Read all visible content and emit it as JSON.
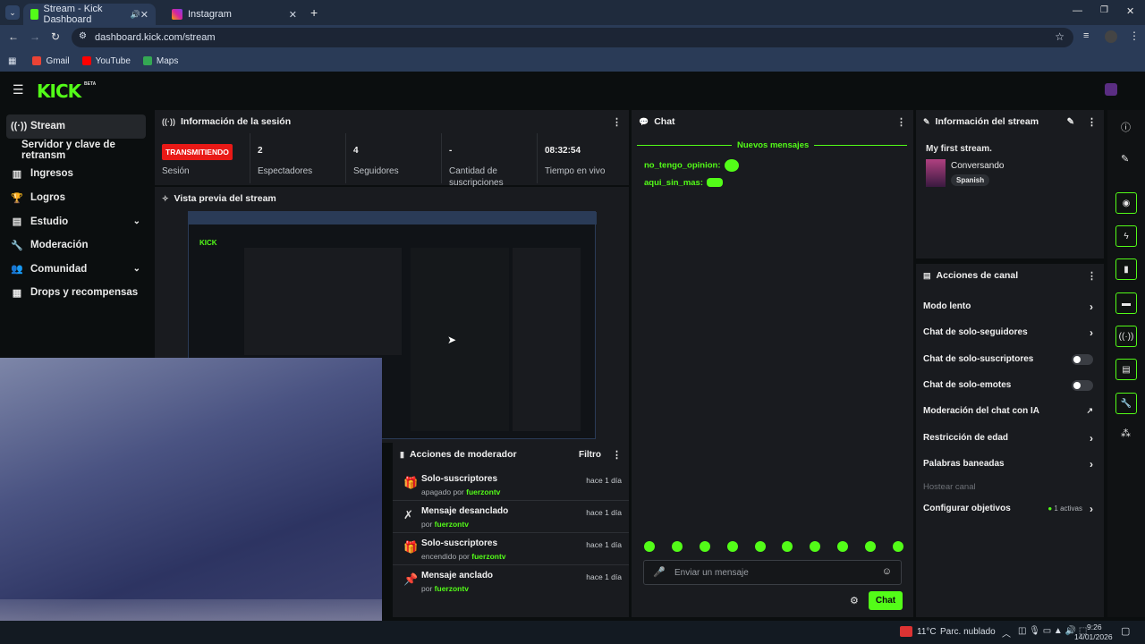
{
  "browser": {
    "tabs": [
      {
        "title": "Stream - Kick Dashboard",
        "active": true
      },
      {
        "title": "Instagram",
        "active": false
      }
    ],
    "url": "dashboard.kick.com/stream",
    "bookmarks": [
      "Gmail",
      "YouTube",
      "Maps"
    ]
  },
  "kick": {
    "logo": "KICK",
    "beta": "BETA"
  },
  "sidebar": {
    "items": [
      {
        "label": "Stream",
        "icon": "broadcast-icon"
      },
      {
        "label": "Servidor y clave de retransm",
        "icon": ""
      },
      {
        "label": "Ingresos",
        "icon": "chart-icon"
      },
      {
        "label": "Logros",
        "icon": "trophy-icon"
      },
      {
        "label": "Estudio",
        "icon": "grid-icon"
      },
      {
        "label": "Moderación",
        "icon": "wrench-icon"
      },
      {
        "label": "Comunidad",
        "icon": "people-icon"
      },
      {
        "label": "Drops y recompensas",
        "icon": "gift-icon"
      }
    ]
  },
  "session": {
    "title": "Información de la sesión",
    "status": "TRANSMITIENDO",
    "status_label": "Sesión",
    "viewers": "2",
    "viewers_label": "Espectadores",
    "followers": "4",
    "followers_label": "Seguidores",
    "subs": "-",
    "subs_label": "Cantidad de suscripciones",
    "live_time": "08:32:54",
    "live_time_label": "Tiempo en vivo"
  },
  "preview": {
    "title": "Vista previa del stream"
  },
  "mod_actions": {
    "title": "Acciones de moderador",
    "filter": "Filtro",
    "rows": [
      {
        "title": "Solo-suscriptores",
        "sub": "apagado por",
        "user": "fuerzontv",
        "time": "hace 1 día"
      },
      {
        "title": "Mensaje desanclado",
        "sub": "por",
        "user": "fuerzontv",
        "time": "hace 1 día"
      },
      {
        "title": "Solo-suscriptores",
        "sub": "encendido por",
        "user": "fuerzontv",
        "time": "hace 1 día"
      },
      {
        "title": "Mensaje anclado",
        "sub": "por",
        "user": "fuerzontv",
        "time": "hace 1 día"
      }
    ]
  },
  "chat": {
    "title": "Chat",
    "new_messages": "Nuevos mensajes",
    "messages": [
      {
        "user": "no_tengo_opinion:"
      },
      {
        "user": "aqui_sin_mas:"
      }
    ],
    "placeholder": "Enviar un mensaje",
    "send": "Chat"
  },
  "stream_info": {
    "title": "Información del stream",
    "stream_title": "My first stream.",
    "category": "Conversando",
    "language": "Spanish"
  },
  "channel_actions": {
    "title": "Acciones de canal",
    "rows": [
      {
        "label": "Modo lento",
        "kind": "arrow"
      },
      {
        "label": "Chat de solo-seguidores",
        "kind": "arrow"
      },
      {
        "label": "Chat de solo-suscriptores",
        "kind": "toggle"
      },
      {
        "label": "Chat de solo-emotes",
        "kind": "toggle"
      },
      {
        "label": "Moderación del chat con IA",
        "kind": "external"
      },
      {
        "label": "Restricción de edad",
        "kind": "arrow"
      },
      {
        "label": "Palabras baneadas",
        "kind": "arrow"
      },
      {
        "label": "Hostear canal",
        "kind": "disabled"
      },
      {
        "label": "Configurar objetivos",
        "kind": "arrow"
      }
    ],
    "goals_active": "1 activas"
  },
  "taskbar": {
    "weather": "11°C",
    "weather_desc": "Parc. nublado",
    "time": "9:26",
    "date": "14/01/2026"
  },
  "colors": {
    "accent": "#53fc18",
    "live": "#e91916",
    "panel": "#191b1f"
  }
}
